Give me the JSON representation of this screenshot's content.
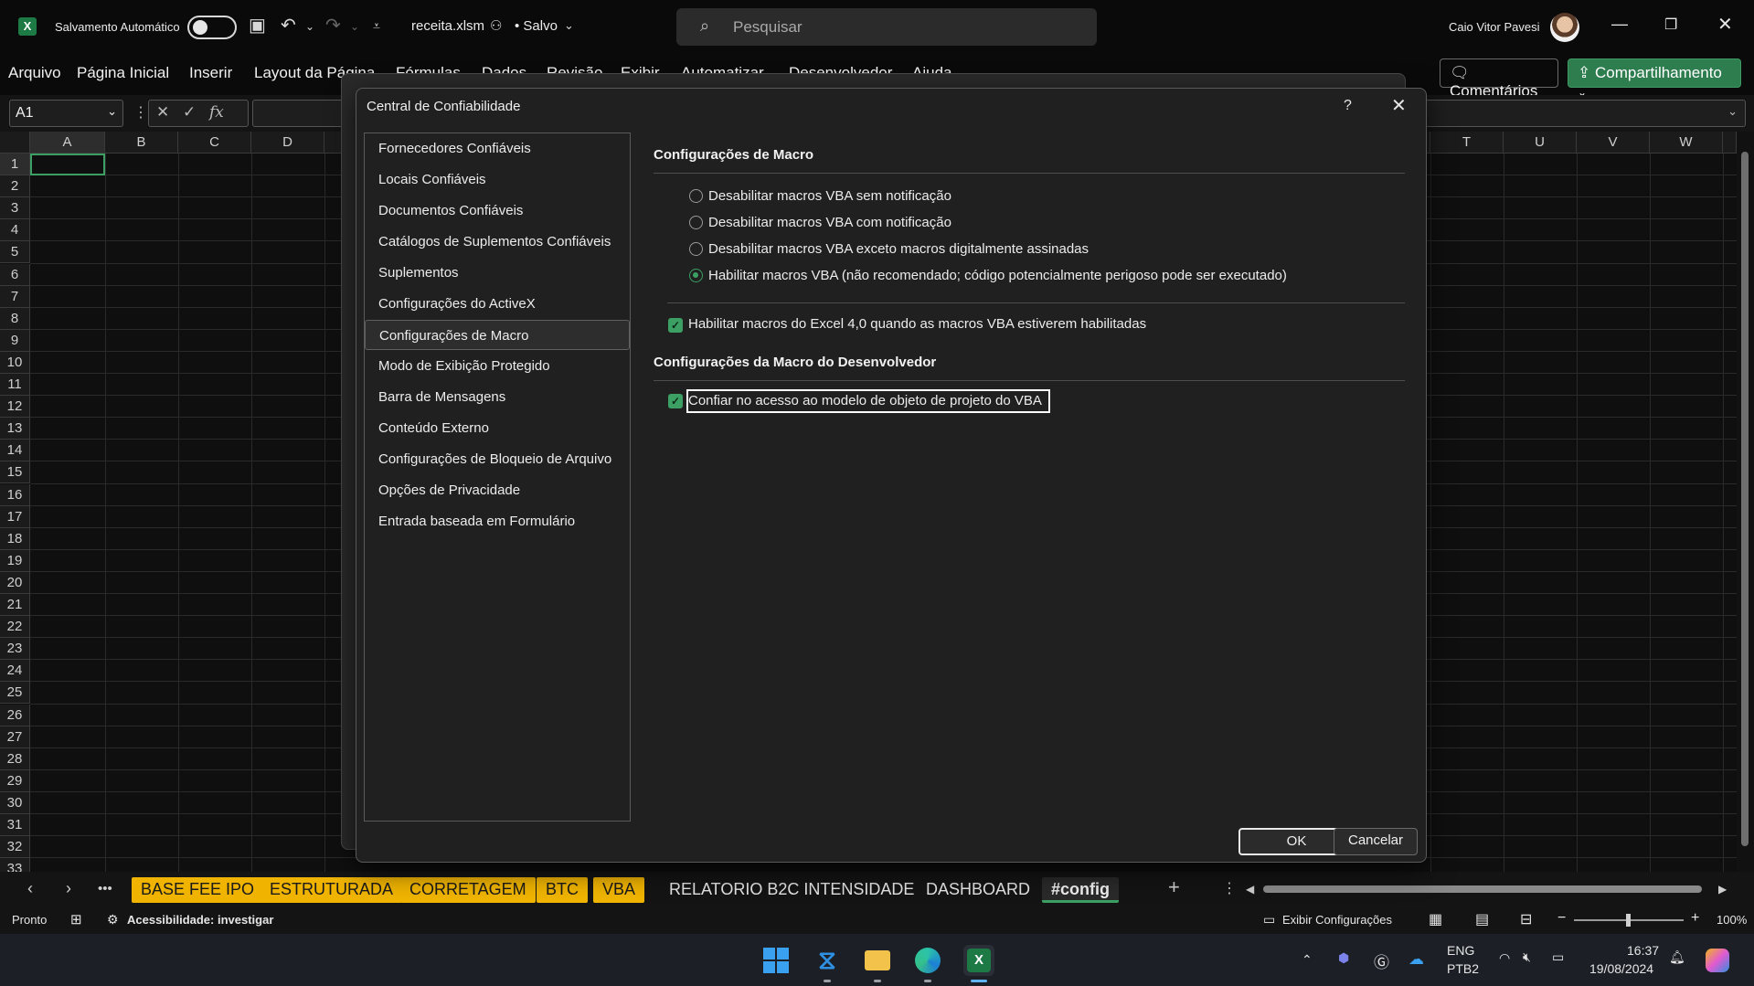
{
  "titlebar": {
    "autosave_label": "Salvamento Automático",
    "filename": "receita.xlsm",
    "saved_status": "• Salvo",
    "search_placeholder": "Pesquisar",
    "user_name": "Caio Vitor Pavesi"
  },
  "ribbon": {
    "tabs": [
      "Arquivo",
      "Página Inicial",
      "Inserir",
      "Layout da Página",
      "Fórmulas",
      "Dados",
      "Revisão",
      "Exibir",
      "Automatizar",
      "Desenvolvedor",
      "Ajuda"
    ],
    "comments_label": "Comentários",
    "share_label": "Compartilhamento"
  },
  "formula_bar": {
    "name_box": "A1",
    "fx_label": "fx"
  },
  "grid": {
    "columns_left": [
      "A",
      "B",
      "C",
      "D"
    ],
    "columns_right": [
      "T",
      "U",
      "V",
      "W"
    ],
    "rows": [
      "1",
      "2",
      "3",
      "4",
      "5",
      "6",
      "7",
      "8",
      "9",
      "10",
      "11",
      "12",
      "13",
      "14",
      "15",
      "16",
      "17",
      "18",
      "19",
      "20",
      "21",
      "22",
      "23",
      "24",
      "25",
      "26",
      "27",
      "28",
      "29",
      "30",
      "31",
      "32",
      "33"
    ]
  },
  "sheet_tabs": {
    "more": "•••",
    "tabs": [
      {
        "label": "BASE FEE IPO",
        "style": "yellow"
      },
      {
        "label": "ESTRUTURADA",
        "style": "yellow"
      },
      {
        "label": "CORRETAGEM",
        "style": "yellow"
      },
      {
        "label": "BTC",
        "style": "yellow"
      },
      {
        "label": "VBA",
        "style": "yellow"
      },
      {
        "label": "RELATORIO B2C INTENSIDADE",
        "style": "plain"
      },
      {
        "label": "DASHBOARD",
        "style": "plain"
      },
      {
        "label": "#config",
        "style": "active"
      }
    ]
  },
  "status_bar": {
    "ready": "Pronto",
    "accessibility": "Acessibilidade: investigar",
    "display_settings": "Exibir Configurações",
    "zoom": "100%"
  },
  "taskbar": {
    "lang_top": "ENG",
    "lang_bottom": "PTB2",
    "time": "16:37",
    "date": "19/08/2024"
  },
  "dialog": {
    "title": "Central de Confiabilidade",
    "help": "?",
    "nav_items": [
      "Fornecedores Confiáveis",
      "Locais Confiáveis",
      "Documentos Confiáveis",
      "Catálogos de Suplementos Confiáveis",
      "Suplementos",
      "Configurações do ActiveX",
      "Configurações de Macro",
      "Modo de Exibição Protegido",
      "Barra de Mensagens",
      "Conteúdo Externo",
      "Configurações de Bloqueio de Arquivo",
      "Opções de Privacidade",
      "Entrada baseada em Formulário"
    ],
    "selected_nav": "Configurações de Macro",
    "macro_section_title": "Configurações de Macro",
    "macro_options": [
      {
        "label": "Desabilitar macros VBA sem notificação",
        "selected": false
      },
      {
        "label": "Desabilitar macros VBA com notificação",
        "selected": false
      },
      {
        "label": "Desabilitar macros VBA exceto macros digitalmente assinadas",
        "selected": false
      },
      {
        "label": "Habilitar macros VBA (não recomendado; código potencialmente perigoso pode ser executado)",
        "selected": true
      }
    ],
    "excel4_checkbox": {
      "label": "Habilitar macros do Excel 4,0 quando as macros VBA estiverem habilitadas",
      "checked": true
    },
    "dev_section_title": "Configurações da Macro do Desenvolvedor",
    "vba_trust_checkbox": {
      "label": "Confiar no acesso ao modelo de objeto de projeto do VBA",
      "checked": true
    },
    "ok_label": "OK",
    "cancel_label": "Cancelar"
  },
  "colors": {
    "accent_green": "#3ca065",
    "sheet_tab_yellow": "#f0b400",
    "share_button": "#2e7d4f"
  }
}
